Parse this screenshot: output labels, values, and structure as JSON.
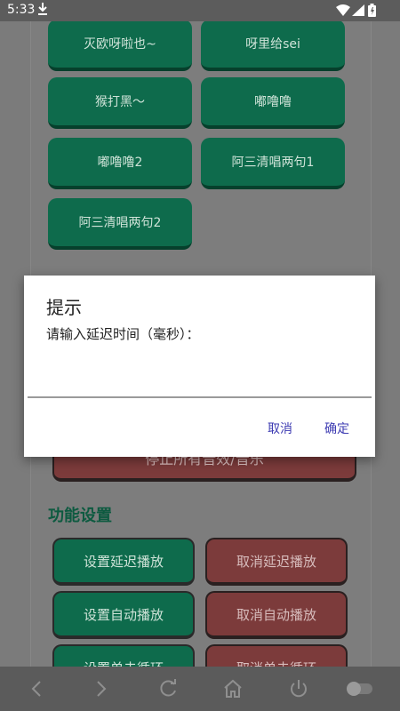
{
  "status_bar": {
    "time": "5:33"
  },
  "sound_buttons": [
    {
      "label": "灭欧呀啦也~"
    },
    {
      "label": "呀里给sei"
    },
    {
      "label": "猴打黑～"
    },
    {
      "label": "嘟噜噜"
    },
    {
      "label": "嘟噜噜2"
    },
    {
      "label": "阿三清唱两句1"
    },
    {
      "label": "阿三清唱两句2"
    }
  ],
  "stop_all_button": {
    "label": "停止所有音效/音乐"
  },
  "function_settings": {
    "title": "功能设置",
    "buttons": [
      {
        "label": "设置延迟播放"
      },
      {
        "label": "取消延迟播放"
      },
      {
        "label": "设置自动播放"
      },
      {
        "label": "取消自动播放"
      },
      {
        "label": "设置单击循环"
      },
      {
        "label": "取消单击循环"
      }
    ]
  },
  "dialog": {
    "title": "提示",
    "message": "请输入延迟时间（毫秒）：",
    "input_value": "",
    "cancel_label": "取消",
    "confirm_label": "确定"
  },
  "colors": {
    "green_button": "#0e6b4c",
    "red_button": "#7c3b3b",
    "dialog_action": "#3d3bb2",
    "section_title": "#0d5a40"
  },
  "icons": {
    "status": [
      "download-icon",
      "wifi-icon",
      "signal-icon",
      "battery-icon"
    ],
    "nav": [
      "back-icon",
      "forward-icon",
      "refresh-icon",
      "home-icon",
      "power-icon",
      "toggle-icon"
    ]
  }
}
